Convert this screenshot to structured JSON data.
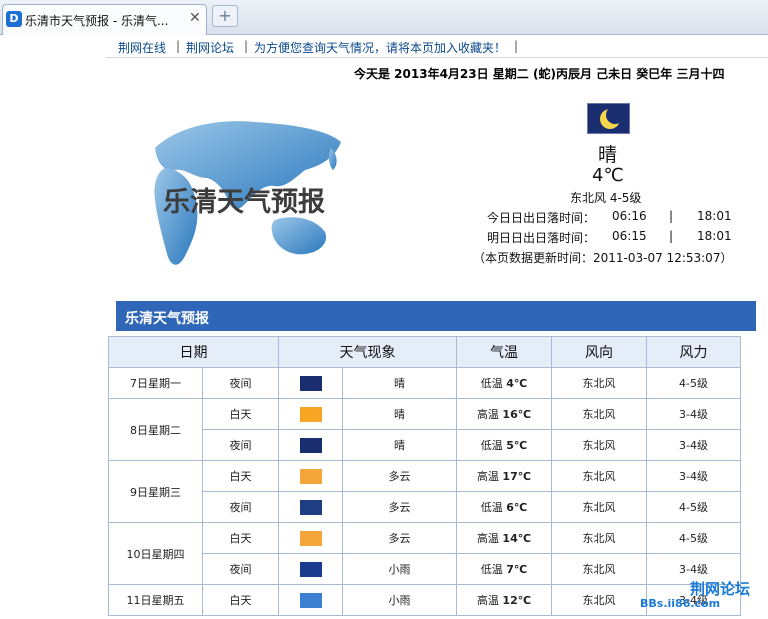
{
  "browser": {
    "tab_title": "乐清市天气预报 - 乐清气...",
    "close_glyph": "✕",
    "newtab_glyph": "+",
    "favicon_letter": "D"
  },
  "toplinks": {
    "link1": "荆网在线",
    "sep": "|",
    "link2": "荆网论坛",
    "notice": "为方便您查询天气情况，请将本页加入收藏夹！"
  },
  "date_line": "今天是 2013年4月23日 星期二 (蛇)丙辰月 己未日 癸巳年 三月十四",
  "hero": {
    "map_title": "乐清天气预报",
    "icon": "moon-icon",
    "condition": "晴",
    "temperature": "4℃",
    "wind": "东北风 4-5级",
    "today_sun": {
      "label": "今日日出日落时间：",
      "rise": "06:16",
      "sep": "|",
      "set": "18:01"
    },
    "tomorrow_sun": {
      "label": "明日日出日落时间：",
      "rise": "06:15",
      "sep": "|",
      "set": "18:01"
    },
    "updated": "（本页数据更新时间：2011-03-07 12:53:07）"
  },
  "section_title": "乐清天气预报",
  "table": {
    "headers": [
      "日期",
      "天气现象",
      "气温",
      "风向",
      "风力"
    ],
    "days": [
      {
        "date": "7日星期一",
        "rows": [
          {
            "period": "夜间",
            "icon": "moon-icon",
            "weather": "晴",
            "temp_label": "低温",
            "temp": "4℃",
            "wind_dir": "东北风",
            "wind_force": "4-5级"
          }
        ]
      },
      {
        "date": "8日星期二",
        "rows": [
          {
            "period": "白天",
            "icon": "sun-icon",
            "weather": "晴",
            "temp_label": "高温",
            "temp": "16℃",
            "wind_dir": "东北风",
            "wind_force": "3-4级"
          },
          {
            "period": "夜间",
            "icon": "moon-icon",
            "weather": "晴",
            "temp_label": "低温",
            "temp": "5℃",
            "wind_dir": "东北风",
            "wind_force": "3-4级"
          }
        ]
      },
      {
        "date": "9日星期三",
        "rows": [
          {
            "period": "白天",
            "icon": "partly-cloudy-day-icon",
            "weather": "多云",
            "temp_label": "高温",
            "temp": "17℃",
            "wind_dir": "东北风",
            "wind_force": "3-4级"
          },
          {
            "period": "夜间",
            "icon": "partly-cloudy-night-icon",
            "weather": "多云",
            "temp_label": "低温",
            "temp": "6℃",
            "wind_dir": "东北风",
            "wind_force": "4-5级"
          }
        ]
      },
      {
        "date": "10日星期四",
        "rows": [
          {
            "period": "白天",
            "icon": "partly-cloudy-day-icon",
            "weather": "多云",
            "temp_label": "高温",
            "temp": "14℃",
            "wind_dir": "东北风",
            "wind_force": "4-5级"
          },
          {
            "period": "夜间",
            "icon": "rain-night-icon",
            "weather": "小雨",
            "temp_label": "低温",
            "temp": "7℃",
            "wind_dir": "东北风",
            "wind_force": "3-4级"
          }
        ]
      },
      {
        "date": "11日星期五",
        "rows": [
          {
            "period": "白天",
            "icon": "rain-day-icon",
            "weather": "小雨",
            "temp_label": "高温",
            "temp": "12℃",
            "wind_dir": "东北风",
            "wind_force": "3-4级"
          }
        ]
      }
    ]
  },
  "watermark": {
    "brand": "荆网论坛",
    "url": "BBs.ii86.com"
  },
  "colors": {
    "section_bar": "#2f66b8",
    "header_bg": "#e5edf8",
    "link": "#0b4a8c",
    "watermark": "#1b7ad6"
  }
}
